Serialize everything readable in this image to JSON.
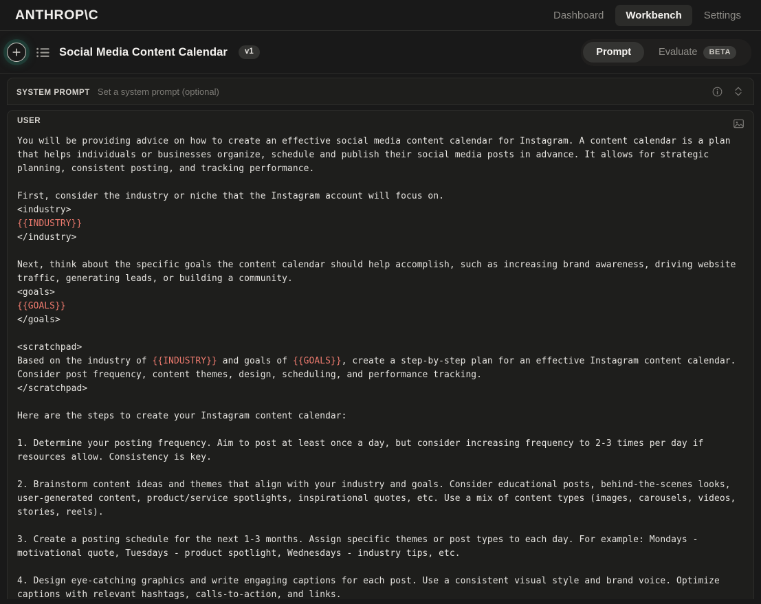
{
  "topbar": {
    "brand": "ANTHROP\\C",
    "nav": [
      {
        "label": "Dashboard",
        "active": false
      },
      {
        "label": "Workbench",
        "active": true
      },
      {
        "label": "Settings",
        "active": false
      }
    ]
  },
  "toolbar": {
    "new_icon": "plus-circle-icon",
    "list_icon": "list-icon",
    "title": "Social Media Content Calendar",
    "version_badge": "v1",
    "segmented": {
      "prompt_label": "Prompt",
      "evaluate_label": "Evaluate",
      "beta_label": "BETA"
    }
  },
  "system_prompt": {
    "label": "SYSTEM PROMPT",
    "placeholder": "Set a system prompt (optional)",
    "info_icon": "info-icon",
    "expand_icon": "expand-collapse-icon"
  },
  "user_prompt": {
    "label": "USER",
    "image_icon": "image-icon",
    "variable_color": "#ed7a6e",
    "segments": [
      {
        "type": "text",
        "value": "You will be providing advice on how to create an effective social media content calendar for Instagram. A content calendar is a plan that helps individuals or businesses organize, schedule and publish their social media posts in advance. It allows for strategic planning, consistent posting, and tracking performance.\n\nFirst, consider the industry or niche that the Instagram account will focus on.\n<industry>\n"
      },
      {
        "type": "variable",
        "value": "{{INDUSTRY}}"
      },
      {
        "type": "text",
        "value": "\n</industry>\n\nNext, think about the specific goals the content calendar should help accomplish, such as increasing brand awareness, driving website traffic, generating leads, or building a community.\n<goals>\n"
      },
      {
        "type": "variable",
        "value": "{{GOALS}}"
      },
      {
        "type": "text",
        "value": "\n</goals>\n\n<scratchpad>\nBased on the industry of "
      },
      {
        "type": "variable",
        "value": "{{INDUSTRY}}"
      },
      {
        "type": "text",
        "value": " and goals of "
      },
      {
        "type": "variable",
        "value": "{{GOALS}}"
      },
      {
        "type": "text",
        "value": ", create a step-by-step plan for an effective Instagram content calendar. Consider post frequency, content themes, design, scheduling, and performance tracking.\n</scratchpad>\n\nHere are the steps to create your Instagram content calendar:\n\n1. Determine your posting frequency. Aim to post at least once a day, but consider increasing frequency to 2-3 times per day if resources allow. Consistency is key.\n\n2. Brainstorm content ideas and themes that align with your industry and goals. Consider educational posts, behind-the-scenes looks, user-generated content, product/service spotlights, inspirational quotes, etc. Use a mix of content types (images, carousels, videos, stories, reels).\n\n3. Create a posting schedule for the next 1-3 months. Assign specific themes or post types to each day. For example: Mondays - motivational quote, Tuesdays - product spotlight, Wednesdays - industry tips, etc.\n\n4. Design eye-catching graphics and write engaging captions for each post. Use a consistent visual style and brand voice. Optimize captions with relevant hashtags, calls-to-action, and links."
      }
    ]
  }
}
